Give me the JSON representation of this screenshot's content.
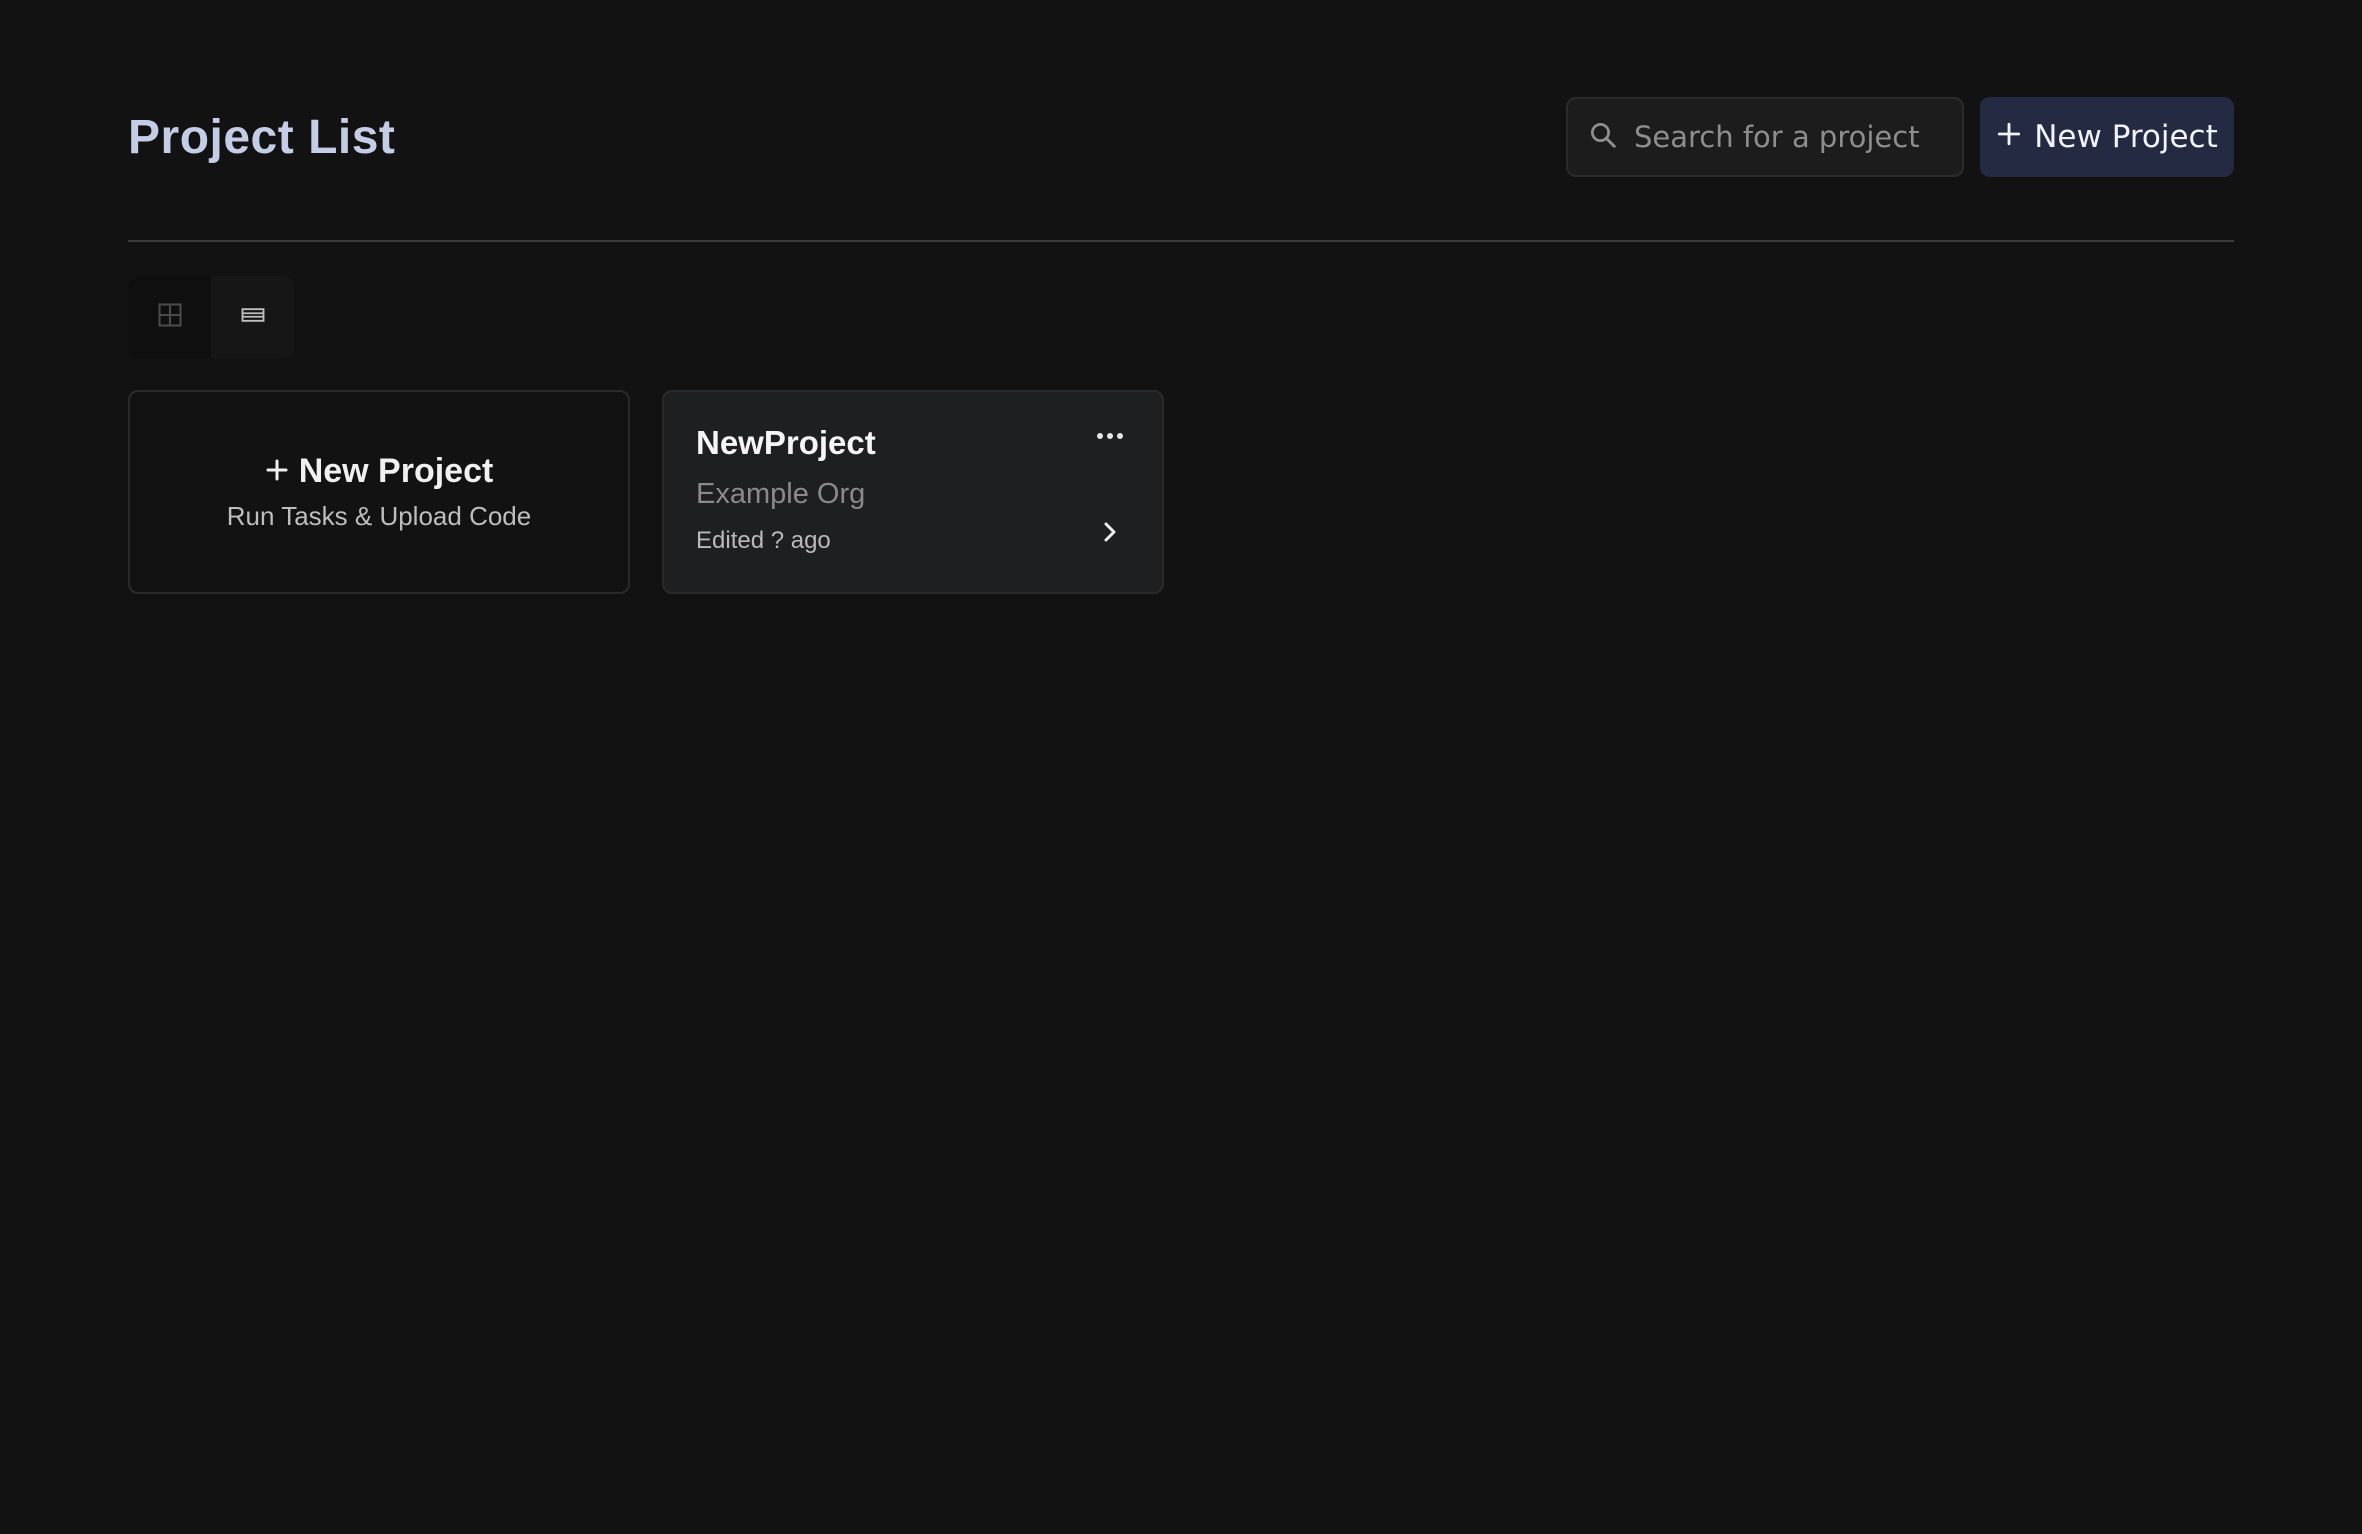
{
  "header": {
    "title": "Project List",
    "search": {
      "placeholder": "Search for a project",
      "value": "",
      "icon": "search-icon"
    },
    "new_project_button": {
      "label": "New Project",
      "icon": "plus-icon"
    }
  },
  "view_toggle": {
    "options": [
      {
        "name": "grid",
        "icon": "grid-icon",
        "selected": true
      },
      {
        "name": "list",
        "icon": "list-icon",
        "selected": false
      }
    ]
  },
  "cards": {
    "new_project": {
      "title": "New Project",
      "subtitle": "Run Tasks & Upload Code",
      "icon": "plus-icon"
    },
    "projects": [
      {
        "name": "NewProject",
        "org": "Example Org",
        "edited": "Edited ? ago",
        "menu_icon": "more-horizontal-icon",
        "open_icon": "chevron-right-icon"
      }
    ]
  },
  "colors": {
    "background": "#121212",
    "title": "#c3cde6",
    "button_bg": "#242a41",
    "card_bg": "#1e1f21",
    "border": "#2a2a2a"
  }
}
